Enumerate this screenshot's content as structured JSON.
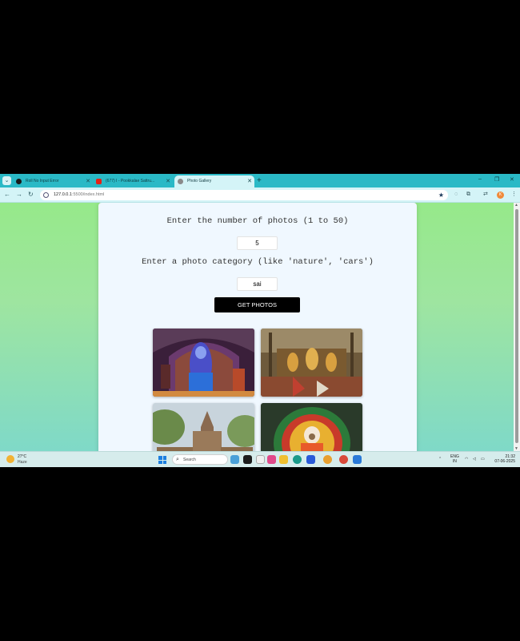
{
  "browser": {
    "tabs": [
      {
        "title": "Roll No Input Error",
        "active": false
      },
      {
        "title": "(677) I - Pookkalae Sattru...",
        "active": false
      },
      {
        "title": "Photo Gallery",
        "active": true
      }
    ],
    "new_tab_label": "+",
    "window_controls": {
      "minimize": "–",
      "restore": "❐",
      "close": "✕"
    },
    "url_host": "127.0.0.1",
    "url_rest": ":5500/index.html",
    "profile_initial": "K"
  },
  "page": {
    "count_prompt": "Enter the number of photos (1 to 50)",
    "count_value": "5",
    "category_prompt": "Enter a photo category (like 'nature', 'cars')",
    "category_value": "sai",
    "button_label": "GET PHOTOS",
    "photos": [
      {
        "subject": "shrine idol under purple light"
      },
      {
        "subject": "temple altar with deities"
      },
      {
        "subject": "ancient stone temple ruins"
      },
      {
        "subject": "sai baba idol with flower garland"
      }
    ]
  },
  "taskbar": {
    "weather_temp": "27°C",
    "weather_condition": "Haze",
    "search_label": "Search",
    "language_top": "ENG",
    "language_bottom": "IN",
    "time": "21:32",
    "date": "07-06-2025"
  },
  "colors": {
    "tab_bar": "#2ab9c6",
    "toolbar": "#d4f4f7",
    "page_gradient_top": "#96e98a",
    "page_gradient_bottom": "#7fd9c8",
    "card_bg": "#f0f8ff",
    "button_bg": "#000000"
  }
}
